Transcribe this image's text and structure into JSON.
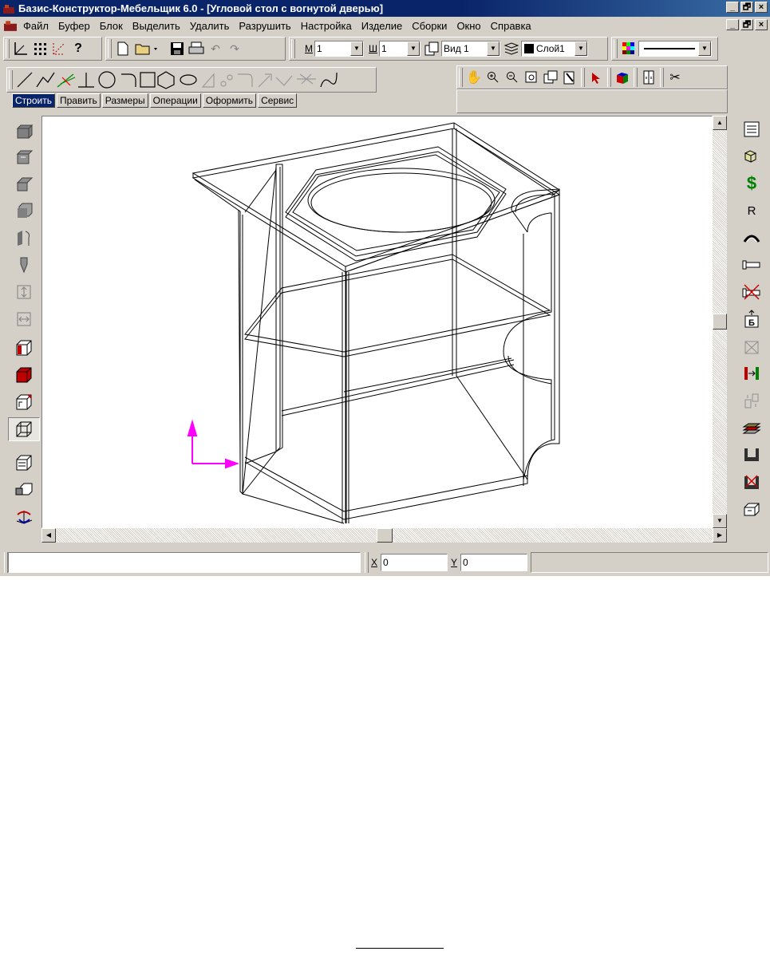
{
  "window": {
    "title": "Базис-Конструктор-Мебельщик 6.0 - [Угловой стол с вогнутой дверью]",
    "controls": [
      "_",
      "🗗",
      "×"
    ]
  },
  "menu": [
    "Файл",
    "Буфер",
    "Блок",
    "Выделить",
    "Удалить",
    "Разрушить",
    "Настройка",
    "Изделие",
    "Сборки",
    "Окно",
    "Справка"
  ],
  "toolbar": {
    "m_label": "М",
    "m_value": "1",
    "w_label": "Ш",
    "w_value": "1",
    "view_value": "Вид 1",
    "layer_value": "Слой1",
    "line_color": "#000000"
  },
  "tabs": [
    "Строить",
    "Править",
    "Размеры",
    "Операции",
    "Оформить",
    "Сервис"
  ],
  "active_tab": "Строить",
  "right_tools": {
    "dollar": "$",
    "r_letter": "R",
    "b_letter": "Б"
  },
  "status": {
    "x_label": "X",
    "x_value": "0",
    "y_label": "Y",
    "y_value": "0"
  },
  "colors": {
    "titlebar": "#0a246a",
    "axis": "#ff00ff",
    "dollar": "#008000"
  }
}
